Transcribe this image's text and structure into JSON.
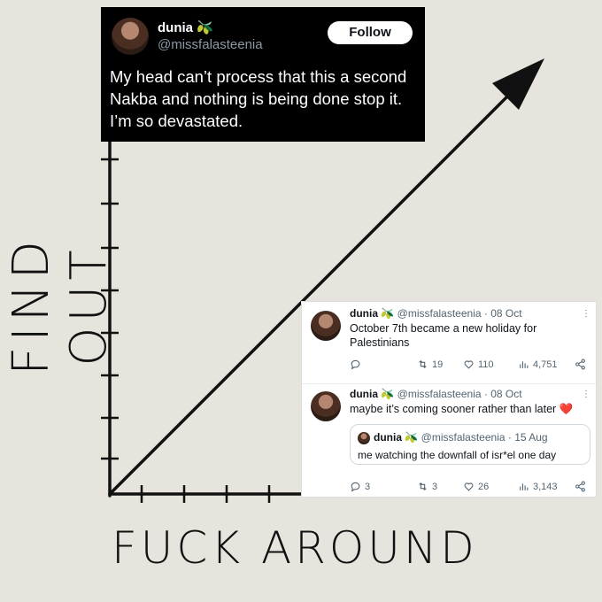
{
  "graph": {
    "y_label": "FIND OUT",
    "x_label": "FUCK AROUND"
  },
  "dark_tweet": {
    "name": "dunia",
    "name_emoji": "🫒",
    "handle": "@missfalasteenia",
    "follow_label": "Follow",
    "text": "My head can’t process that this a second Nakba and nothing is being done stop it. I’m so devastated."
  },
  "tweets": [
    {
      "name": "dunia",
      "emoji": "🫒",
      "meta": "@missfalasteenia · 08 Oct",
      "text": "October 7th became a new holiday for Palestinians",
      "replies": "",
      "retweets": "19",
      "likes": "110",
      "views": "4,751"
    },
    {
      "name": "dunia",
      "emoji": "🫒",
      "meta": "@missfalasteenia · 08 Oct",
      "text": "maybe it’s coming sooner rather  than later ❤️",
      "quote": {
        "name": "dunia",
        "emoji": "🫒",
        "meta": "@missfalasteenia · 15 Aug",
        "text": "me watching the downfall of isr*el one day"
      },
      "replies": "3",
      "retweets": "3",
      "likes": "26",
      "views": "3,143"
    }
  ],
  "icons": {
    "reply": "reply-icon",
    "retweet": "retweet-icon",
    "like": "heart-icon",
    "views": "views-icon",
    "share": "share-icon"
  },
  "colors": {
    "background": "#e7e4de",
    "dark_tweet_bg": "#000000",
    "heart": "#e0245e"
  }
}
